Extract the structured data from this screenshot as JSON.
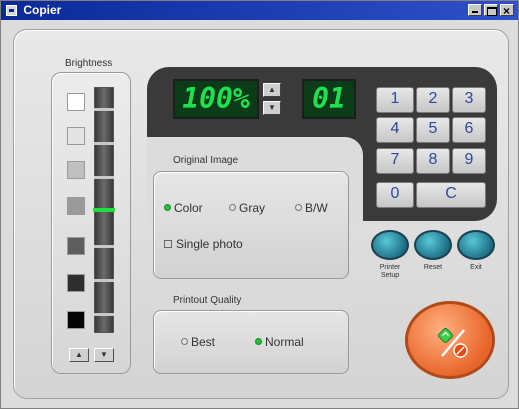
{
  "window": {
    "title": "Copier"
  },
  "brightness": {
    "label": "Brightness",
    "swatches": [
      "#ffffff",
      "#e4e4e4",
      "#bfbfbf",
      "#9a9a9a",
      "#5e5e5e",
      "#2e2e2e",
      "#050505"
    ],
    "level_fraction": 0.5,
    "up_icon": "triangle-up-icon",
    "down_icon": "triangle-down-icon"
  },
  "display": {
    "zoom": "100%",
    "copies": "01"
  },
  "keypad": {
    "keys": [
      "1",
      "2",
      "3",
      "4",
      "5",
      "6",
      "7",
      "8",
      "9",
      "0",
      "C"
    ]
  },
  "original_image": {
    "label": "Original Image",
    "options": [
      "Color",
      "Gray",
      "B/W"
    ],
    "selected": "Color",
    "single_photo": "Single photo"
  },
  "printout_quality": {
    "label": "Printout Quality",
    "options": [
      "Best",
      "Normal"
    ],
    "selected": "Normal"
  },
  "actions": {
    "printer_setup": "Printer Setup",
    "reset": "Reset",
    "exit": "Exit"
  },
  "colors": {
    "lcd_text": "#1fe04e",
    "title_bar": "#0a2a9a",
    "copy_button": "#e8652a",
    "round_buttons": "#1a8aa0"
  }
}
